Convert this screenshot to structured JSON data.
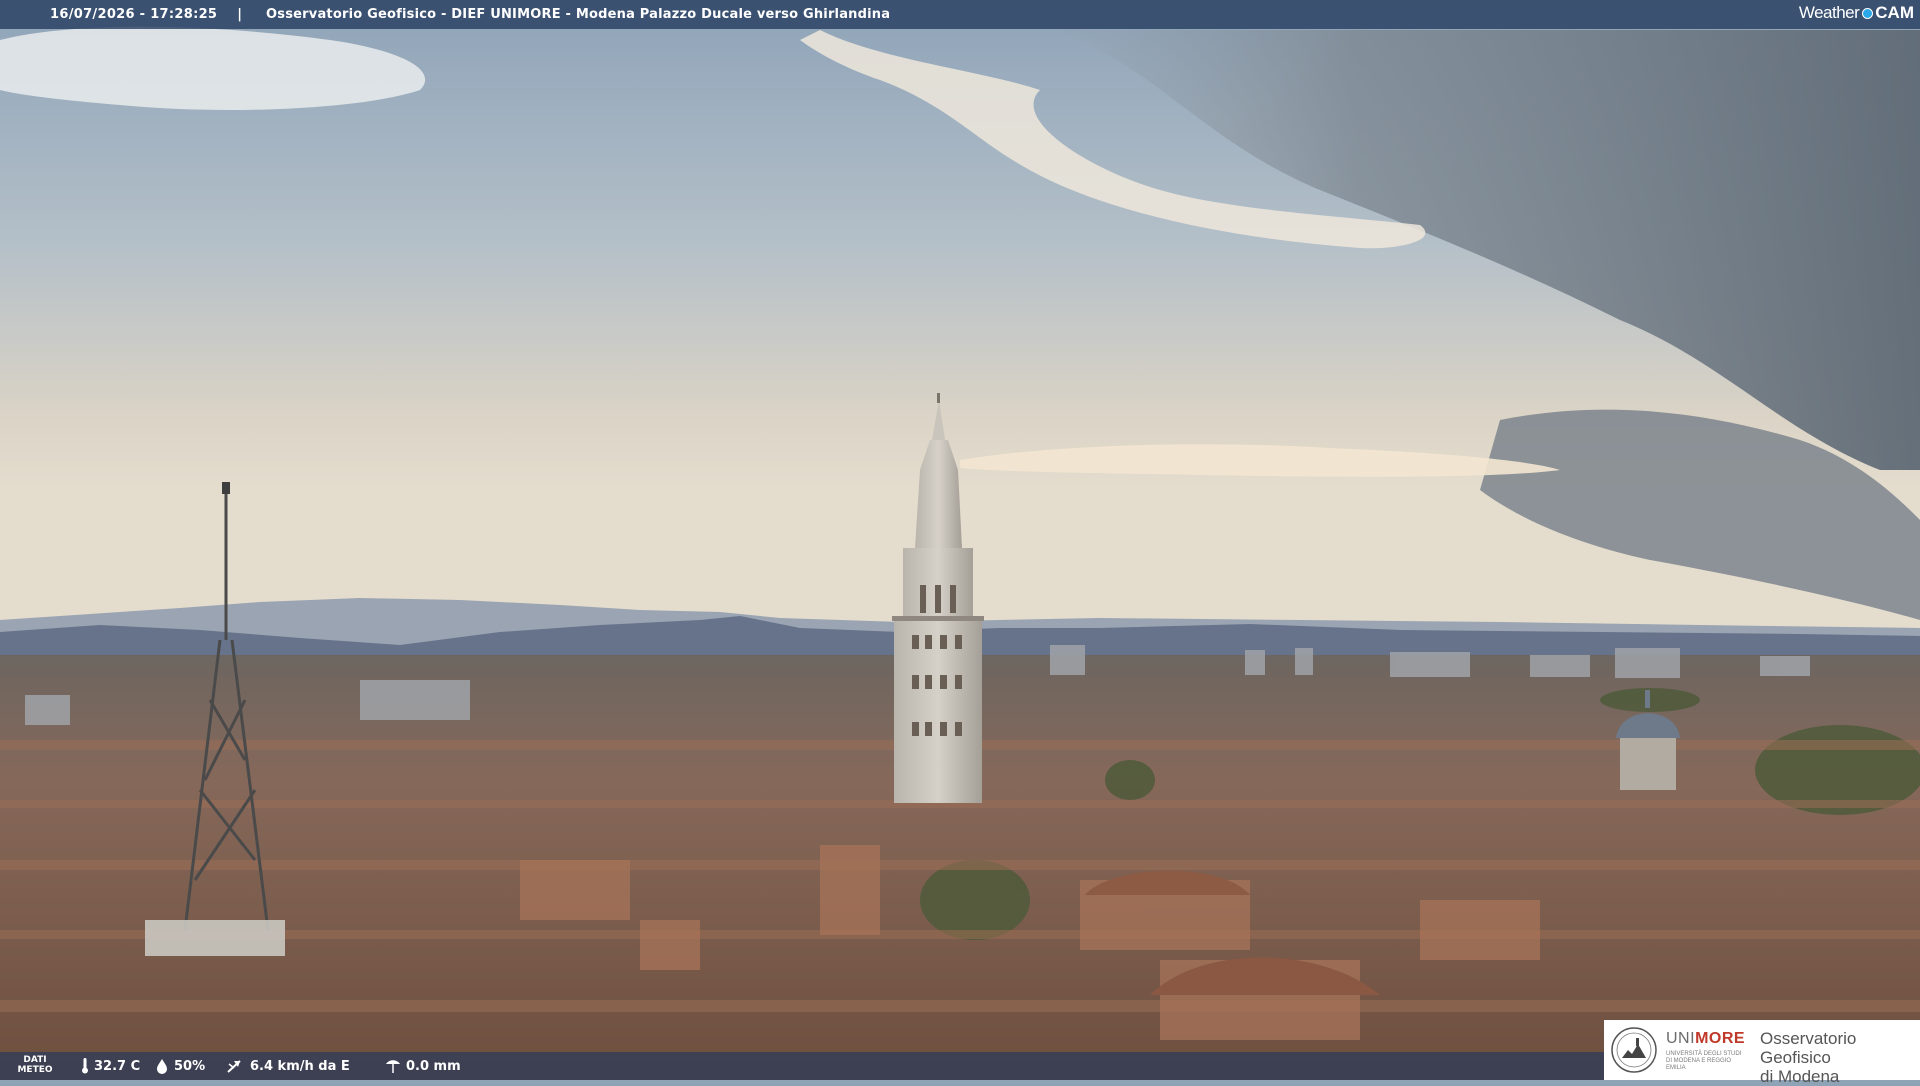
{
  "overlay": {
    "timestamp": "16/07/2026 - 17:28:25",
    "separator": "|",
    "title": "Osservatorio Geofisico - DIEF UNIMORE - Modena Palazzo Ducale verso Ghirlandina"
  },
  "brand": {
    "part1": "Weather",
    "part2": "CAM",
    "icon": "weathercam-dot-icon"
  },
  "meteo": {
    "label_line1": "DATI",
    "label_line2": "METEO",
    "temperature": "32.7 C",
    "humidity": "50%",
    "wind": "6.4 km/h da E",
    "rain": "0.0 mm",
    "icons": [
      "thermometer-icon",
      "humidity-drop-icon",
      "wind-icon",
      "rain-gauge-icon"
    ]
  },
  "logo": {
    "uni_a": "UNI",
    "uni_b": "MORE",
    "uni_sub": "UNIVERSITÀ DEGLI STUDI DI MODENA E REGGIO EMILIA",
    "obs_line1": "Osservatorio Geofisico",
    "obs_line2": "di Modena"
  },
  "colors": {
    "sky_top": "#8ea4ba",
    "sky_haze": "#d9d2c4",
    "storm_cloud": "#67727e",
    "roofs": "#8a6a55",
    "bar": "#233a5c"
  }
}
